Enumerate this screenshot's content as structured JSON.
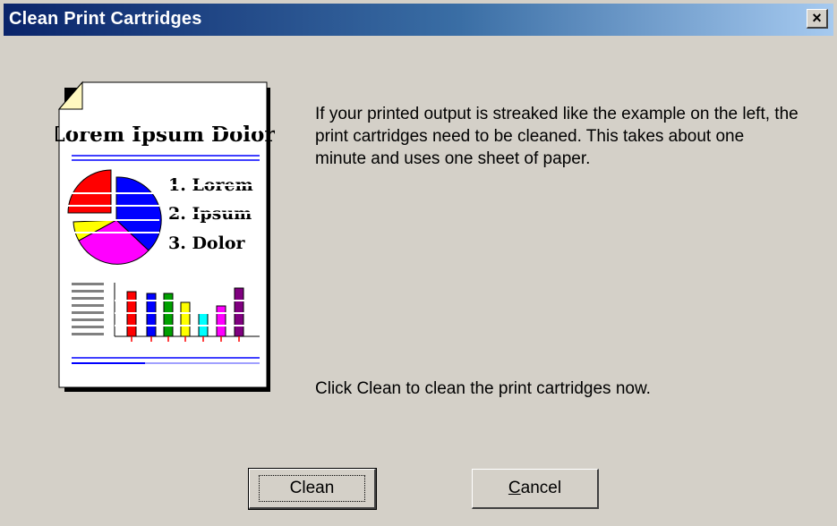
{
  "window": {
    "title": "Clean Print Cartridges",
    "close_glyph": "×"
  },
  "illustration": {
    "icon": "sample-printed-page",
    "heading": "Lorem Ipsum Dolor",
    "list": [
      "1. Lorem",
      "2. Ipsum",
      "3. Dolor"
    ]
  },
  "description": "If your printed output is streaked like the example on the left, the print cartridges need to be cleaned.  This takes about one minute and uses one sheet of paper.",
  "instruction": "Click Clean to clean the print cartridges now.",
  "buttons": {
    "clean_label": "Clean",
    "cancel_first": "C",
    "cancel_rest": "ancel"
  },
  "colors": {
    "titlebar_start": "#0a246a",
    "titlebar_end": "#a6caf0",
    "dialog_bg": "#d4d0c8"
  }
}
